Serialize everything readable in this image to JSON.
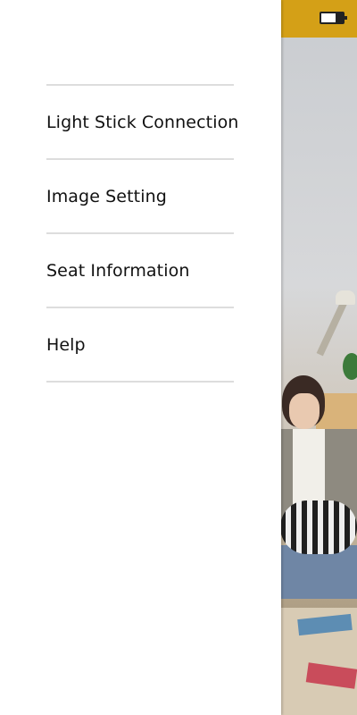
{
  "status_bar": {
    "accent_color": "#d4a017",
    "icons": [
      "battery-icon"
    ]
  },
  "drawer": {
    "menu": [
      {
        "label": "Light Stick Connection"
      },
      {
        "label": "Image Setting"
      },
      {
        "label": "Seat Information"
      },
      {
        "label": "Help"
      }
    ],
    "divider_color": "#dddddd",
    "text_color": "#111111"
  }
}
